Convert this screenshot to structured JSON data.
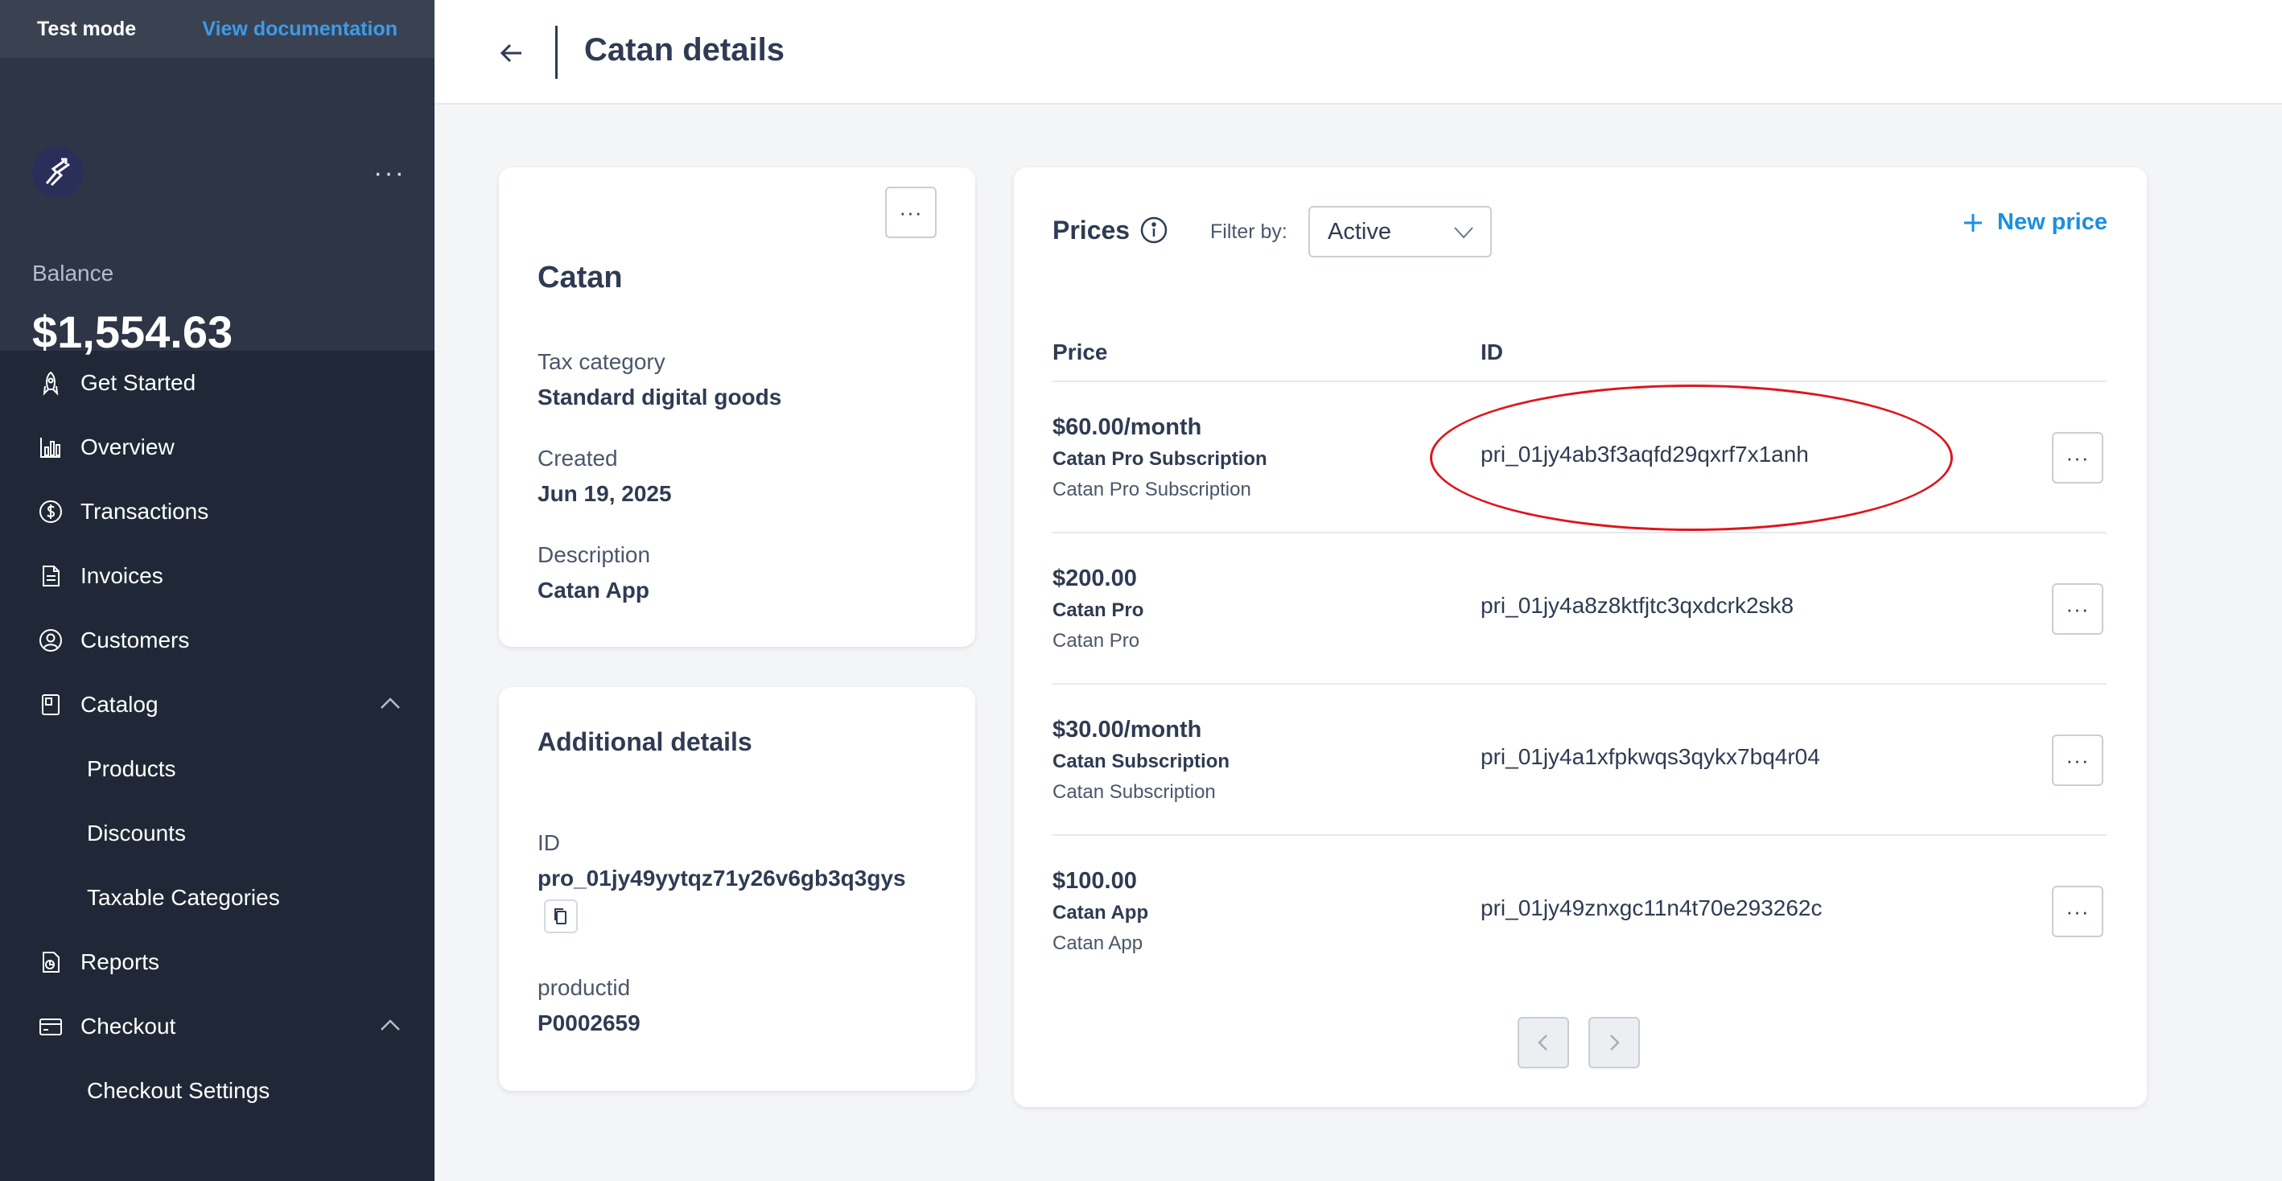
{
  "topbar": {
    "mode": "Test mode",
    "doc_link": "View documentation"
  },
  "balance": {
    "label": "Balance",
    "value": "$1,554.63"
  },
  "sidebar": {
    "items": [
      {
        "label": "Get Started",
        "icon": "rocket-icon"
      },
      {
        "label": "Overview",
        "icon": "bar-chart-icon"
      },
      {
        "label": "Transactions",
        "icon": "dollar-circle-icon"
      },
      {
        "label": "Invoices",
        "icon": "document-icon"
      },
      {
        "label": "Customers",
        "icon": "user-circle-icon"
      },
      {
        "label": "Catalog",
        "icon": "catalog-icon",
        "expanded": true,
        "children": [
          "Products",
          "Discounts",
          "Taxable Categories"
        ]
      },
      {
        "label": "Reports",
        "icon": "report-icon"
      },
      {
        "label": "Checkout",
        "icon": "credit-card-icon",
        "expanded": true,
        "children": [
          "Checkout Settings"
        ]
      }
    ]
  },
  "header": {
    "title": "Catan details"
  },
  "product": {
    "name": "Catan",
    "tax_category_label": "Tax category",
    "tax_category": "Standard digital goods",
    "created_label": "Created",
    "created": "Jun 19, 2025",
    "description_label": "Description",
    "description": "Catan App"
  },
  "additional": {
    "title": "Additional details",
    "id_label": "ID",
    "id": "pro_01jy49yytqz71y26v6gb3q3gys",
    "custom_label": "productid",
    "custom_value": "P0002659"
  },
  "prices": {
    "title": "Prices",
    "filter_label": "Filter by:",
    "filter_value": "Active",
    "new_price": "New price",
    "col_price": "Price",
    "col_id": "ID",
    "rows": [
      {
        "amount": "$60.00/month",
        "name": "Catan Pro Subscription",
        "description": "Catan Pro Subscription",
        "id": "pri_01jy4ab3f3aqfd29qxrf7x1anh"
      },
      {
        "amount": "$200.00",
        "name": "Catan Pro",
        "description": "Catan Pro",
        "id": "pri_01jy4a8z8ktfjtc3qxdcrk2sk8"
      },
      {
        "amount": "$30.00/month",
        "name": "Catan Subscription",
        "description": "Catan Subscription",
        "id": "pri_01jy4a1xfpkwqs3qykx7bq4r04"
      },
      {
        "amount": "$100.00",
        "name": "Catan App",
        "description": "Catan App",
        "id": "pri_01jy49znxgc11n4t70e293262c"
      }
    ]
  },
  "more_glyph": "···",
  "colors": {
    "sidebar_bg": "#202837",
    "accent": "#1a8fe3",
    "link": "#3d9be9",
    "annotation": "#e0141b"
  }
}
